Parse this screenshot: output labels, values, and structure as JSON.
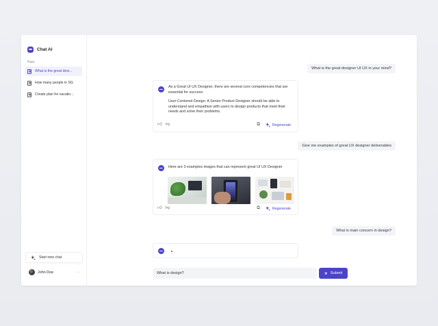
{
  "app": {
    "title": "Chat AI"
  },
  "colors": {
    "accent": "#4b44c9",
    "background": "#eef0f4"
  },
  "sidebar": {
    "section_label": "Past",
    "items": [
      {
        "label": "What is the great desi...",
        "active": true
      },
      {
        "label": "How many people in SG",
        "active": false
      },
      {
        "label": "Create plan for vacatio...",
        "active": false
      }
    ],
    "new_chat_label": "Start new chat",
    "user": {
      "name": "John Doe",
      "more": "···"
    }
  },
  "conversation": {
    "q1": "What is the great designer UI UX in your mind?",
    "a1": {
      "p1": "As a Great UI UX Designer, there are several core competencies that are essential for success:",
      "p2": "User-Centered Design: A Senior Product Designer should be able to understand and empathize with users to design products that meet their needs and solve their problems."
    },
    "q2": "Give me examples of great UX designer deliverables",
    "a2": {
      "text": "Here are 3 examples images that can represent great UI UX Designer"
    },
    "q3": "What is main concern in design?",
    "regenerate_label": "Regenerate"
  },
  "input": {
    "value": "What is design?",
    "submit_label": "Submit"
  }
}
